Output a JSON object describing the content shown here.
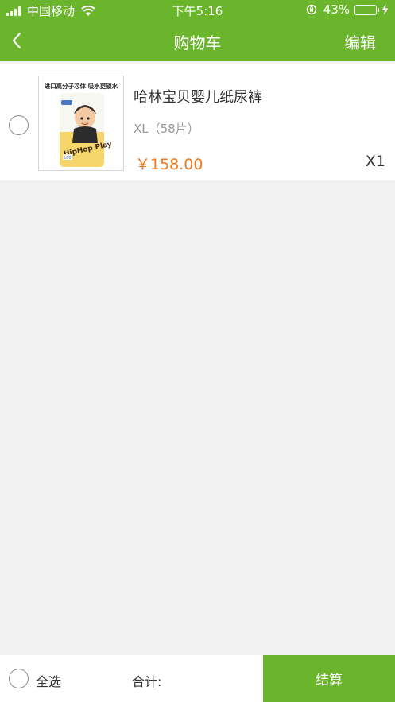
{
  "status_bar": {
    "carrier": "中国移动",
    "time": "下午5:16",
    "battery_percent": "43%",
    "battery_level": 0.43,
    "icons": [
      "signal-icon",
      "wifi-icon",
      "orientation-lock-icon",
      "battery-icon",
      "charging-icon"
    ]
  },
  "nav": {
    "title": "购物车",
    "edit_label": "编辑",
    "back_icon": "chevron-left-icon"
  },
  "cart": {
    "items": [
      {
        "name": "哈林宝贝婴儿纸尿裤",
        "spec": "XL（58片）",
        "price": "￥158.00",
        "quantity": "X1",
        "image_caption": "进口高分子芯体 吸水更锁水",
        "image_brand": "HipHop Play",
        "image_size": "L60"
      }
    ]
  },
  "footer": {
    "select_all_label": "全选",
    "total_label": "合计:",
    "checkout_label": "结算"
  },
  "colors": {
    "brand_green": "#6bb52d",
    "price_orange": "#ef7a19"
  }
}
